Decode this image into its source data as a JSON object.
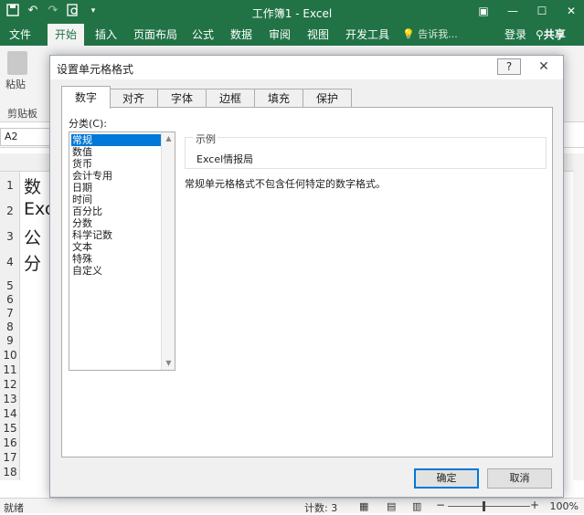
{
  "window": {
    "title": "工作簿1 - Excel",
    "qat_icons": [
      "save-icon",
      "undo-icon",
      "redo-icon",
      "print-preview-icon",
      "customize-icon"
    ]
  },
  "ribbon": {
    "file_tab": "文件",
    "tabs": [
      "开始",
      "插入",
      "页面布局",
      "公式",
      "数据",
      "审阅",
      "视图",
      "开发工具"
    ],
    "active_tab": "开始",
    "tell_me": "告诉我...",
    "login": "登录",
    "share": "共享",
    "clipboard_group": "剪贴板",
    "paste_label": "粘贴"
  },
  "formula_bar": {
    "name_box": "A2"
  },
  "sheet": {
    "rows": [
      "1",
      "2",
      "3",
      "4",
      "5",
      "6",
      "7",
      "8",
      "9",
      "10",
      "11",
      "12",
      "13",
      "14",
      "15",
      "16",
      "17",
      "18"
    ],
    "cells": [
      "数",
      "Exc",
      "公",
      "分"
    ]
  },
  "status_bar": {
    "ready": "就绪",
    "count": "计数: 3",
    "zoom": "100%",
    "minus": "−",
    "plus": "+"
  },
  "dialog": {
    "title": "设置单元格格式",
    "help": "?",
    "close": "✕",
    "tabs": [
      "数字",
      "对齐",
      "字体",
      "边框",
      "填充",
      "保护"
    ],
    "active_tab": "数字",
    "category_label": "分类(C):",
    "categories": [
      "常规",
      "数值",
      "货币",
      "会计专用",
      "日期",
      "时间",
      "百分比",
      "分数",
      "科学记数",
      "文本",
      "特殊",
      "自定义"
    ],
    "selected_category": "常规",
    "sample_label": "示例",
    "sample_value": "Excel情报局",
    "description": "常规单元格格式不包含任何特定的数字格式。",
    "ok": "确定",
    "cancel": "取消"
  },
  "colors": {
    "excel_green": "#217346",
    "selection_blue": "#0078d7"
  }
}
